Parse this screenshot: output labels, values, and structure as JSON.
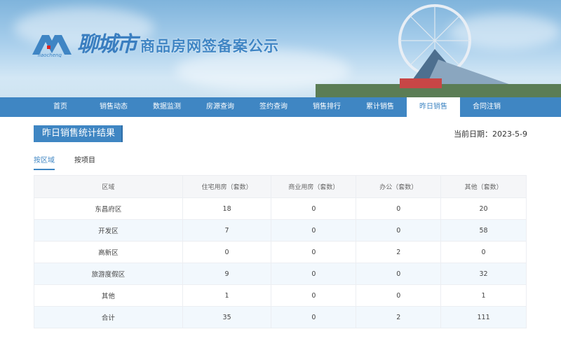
{
  "header": {
    "logo_text": "liaocheng",
    "city": "聊城市",
    "subtitle": "商品房网签备案公示"
  },
  "nav": [
    "首页",
    "销售动态",
    "数据监测",
    "房源查询",
    "签约查询",
    "销售排行",
    "累计销售",
    "昨日销售",
    "合同注销"
  ],
  "active_nav": "昨日销售",
  "page_title": "昨日销售统计结果",
  "date_label": "当前日期：2023-5-9",
  "tabs": [
    "按区域",
    "按项目"
  ],
  "table": {
    "headers": [
      "区域",
      "住宅用房（套数）",
      "商业用房（套数）",
      "办公（套数）",
      "其他（套数）"
    ],
    "rows": [
      [
        "东昌府区",
        "18",
        "0",
        "0",
        "20"
      ],
      [
        "开发区",
        "7",
        "0",
        "0",
        "58"
      ],
      [
        "高新区",
        "0",
        "0",
        "2",
        "0"
      ],
      [
        "旅游度假区",
        "9",
        "0",
        "0",
        "32"
      ],
      [
        "其他",
        "1",
        "0",
        "0",
        "1"
      ],
      [
        "合计",
        "35",
        "0",
        "2",
        "111"
      ]
    ]
  }
}
